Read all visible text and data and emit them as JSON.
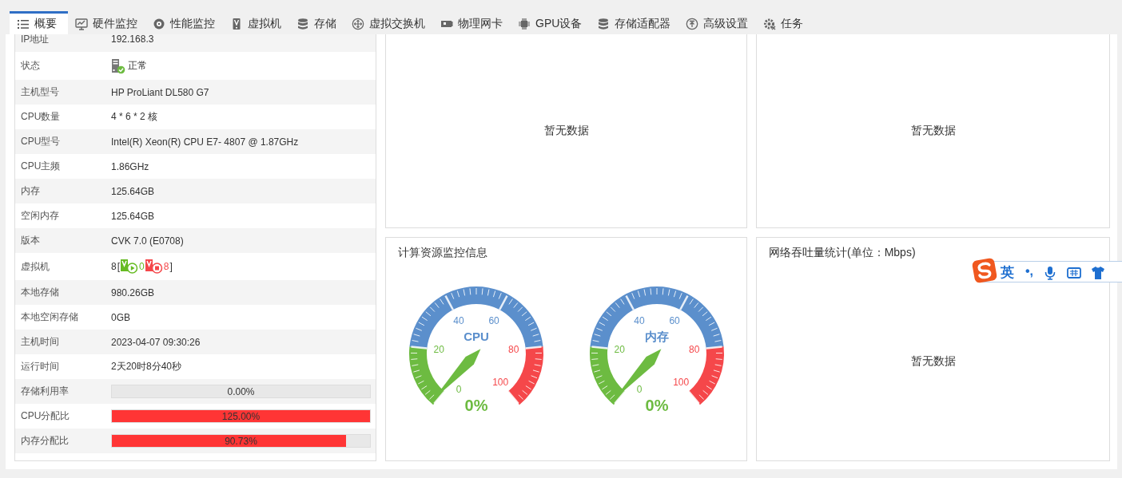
{
  "tabs": [
    {
      "label": "概要",
      "selected": true
    },
    {
      "label": "硬件监控",
      "selected": false
    },
    {
      "label": "性能监控",
      "selected": false
    },
    {
      "label": "虚拟机",
      "selected": false
    },
    {
      "label": "存储",
      "selected": false
    },
    {
      "label": "虚拟交换机",
      "selected": false
    },
    {
      "label": "物理网卡",
      "selected": false
    },
    {
      "label": "GPU设备",
      "selected": false
    },
    {
      "label": "存储适配器",
      "selected": false
    },
    {
      "label": "高级设置",
      "selected": false
    },
    {
      "label": "任务",
      "selected": false
    }
  ],
  "host_info": {
    "rows": [
      {
        "kind": "text",
        "label": "IP地址",
        "value": "192.168.3"
      },
      {
        "kind": "status",
        "label": "状态",
        "value": "正常"
      },
      {
        "kind": "text",
        "label": "主机型号",
        "value": "HP ProLiant DL580 G7"
      },
      {
        "kind": "text",
        "label": "CPU数量",
        "value": "4 * 6 * 2 核"
      },
      {
        "kind": "text",
        "label": "CPU型号",
        "value": "Intel(R) Xeon(R) CPU E7- 4807 @ 1.87GHz"
      },
      {
        "kind": "text",
        "label": "CPU主频",
        "value": "1.86GHz"
      },
      {
        "kind": "text",
        "label": "内存",
        "value": "125.64GB"
      },
      {
        "kind": "text",
        "label": "空闲内存",
        "value": "125.64GB"
      },
      {
        "kind": "text",
        "label": "版本",
        "value": "CVK 7.0 (E0708)"
      },
      {
        "kind": "vm",
        "label": "虚拟机",
        "total": "8",
        "open": "[",
        "running": "0",
        "stopped": "8",
        "close": "]"
      },
      {
        "kind": "text",
        "label": "本地存储",
        "value": "980.26GB"
      },
      {
        "kind": "text",
        "label": "本地空闲存储",
        "value": "0GB"
      },
      {
        "kind": "text",
        "label": "主机时间",
        "value": "2023-04-07 09:30:26"
      },
      {
        "kind": "text",
        "label": "运行时间",
        "value": "2天20时8分40秒"
      },
      {
        "kind": "bar",
        "label": "存储利用率",
        "value": "0.00%",
        "level": 0
      },
      {
        "kind": "bar",
        "label": "CPU分配比",
        "value": "125.00%",
        "level": 1
      },
      {
        "kind": "bar",
        "label": "内存分配比",
        "value": "90.73%",
        "level": 0.9073
      }
    ]
  },
  "panels": [
    {
      "kind": "empty",
      "message": "暂无数据"
    },
    {
      "kind": "empty",
      "message": "暂无数据"
    },
    {
      "kind": "gauges",
      "title": "计算资源监控信息",
      "gauges": [
        {
          "name": "CPU",
          "value": "0%",
          "scale": [
            "0",
            "20",
            "40",
            "60",
            "80",
            "100"
          ]
        },
        {
          "name": "内存",
          "value": "0%",
          "scale": [
            "0",
            "20",
            "40",
            "60",
            "80",
            "100"
          ]
        }
      ]
    },
    {
      "kind": "empty",
      "title": "网络吞吐量统计(单位：Mbps)",
      "message": "暂无数据"
    }
  ],
  "ime_toolbar": {
    "language": "英",
    "punctuation": "•,"
  }
}
